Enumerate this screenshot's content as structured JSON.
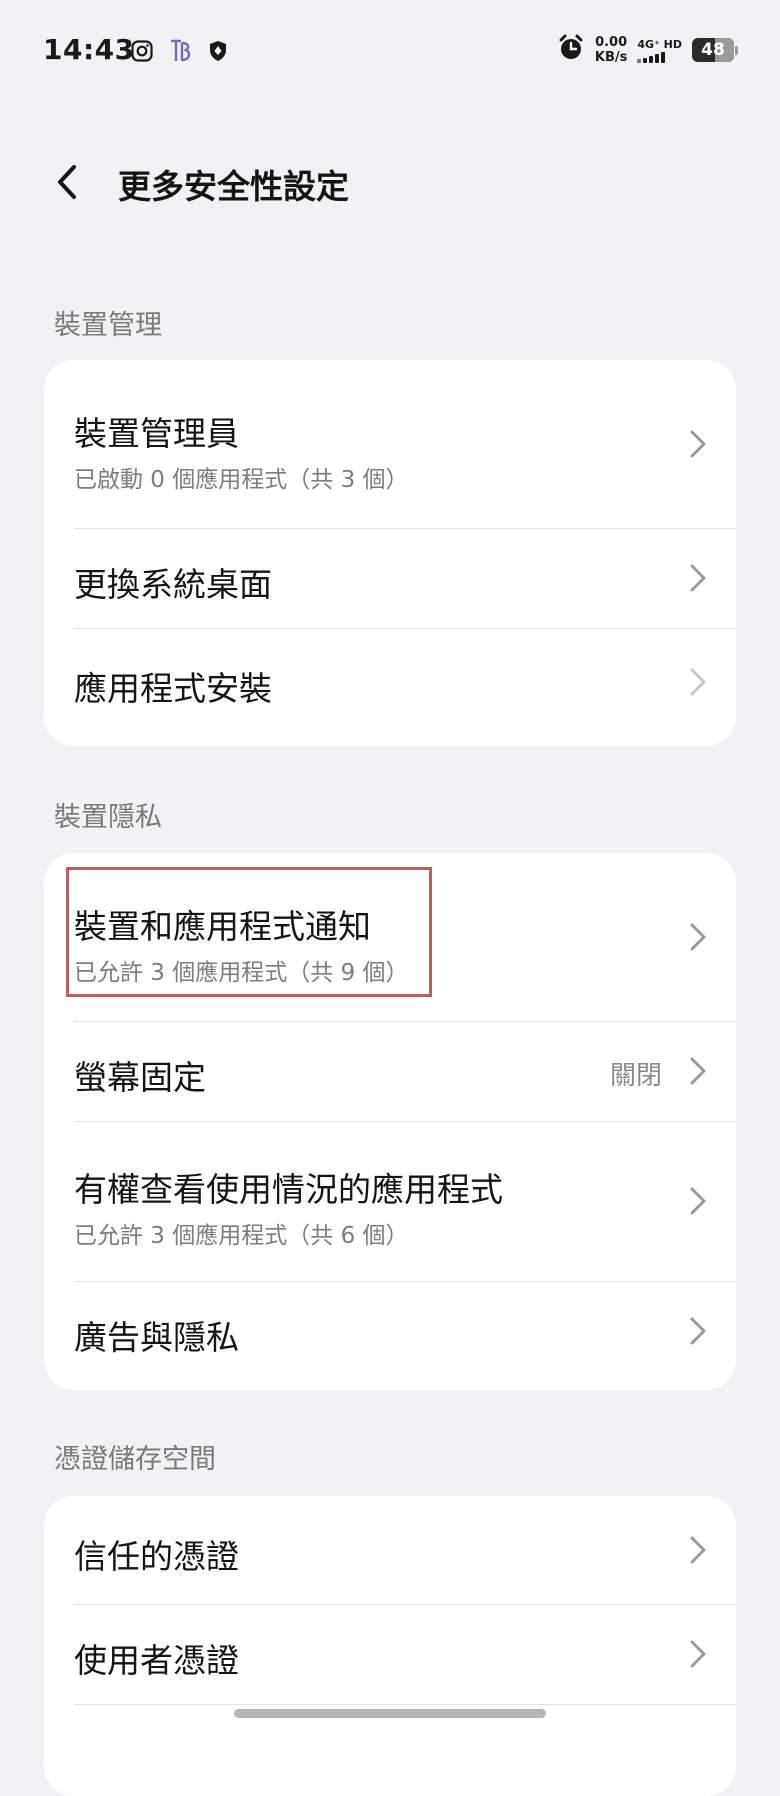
{
  "status_bar": {
    "time": "14:43",
    "net_speed_value": "0.00",
    "net_speed_unit": "KB/s",
    "network_type": "4G⁺ HD",
    "battery": "48"
  },
  "header": {
    "title": "更多安全性設定"
  },
  "sections": {
    "device_management": {
      "label": "裝置管理",
      "items": [
        {
          "title": "裝置管理員",
          "subtitle": "已啟動 0 個應用程式（共 3 個）"
        },
        {
          "title": "更換系統桌面"
        },
        {
          "title": "應用程式安裝"
        }
      ]
    },
    "device_privacy": {
      "label": "裝置隱私",
      "items": [
        {
          "title": "裝置和應用程式通知",
          "subtitle": "已允許 3 個應用程式（共 9 個）"
        },
        {
          "title": "螢幕固定",
          "value": "關閉"
        },
        {
          "title": "有權查看使用情況的應用程式",
          "subtitle": "已允許 3 個應用程式（共 6 個）"
        },
        {
          "title": "廣告與隱私"
        }
      ]
    },
    "credential_storage": {
      "label": "憑證儲存空間",
      "items": [
        {
          "title": "信任的憑證"
        },
        {
          "title": "使用者憑證"
        }
      ]
    }
  },
  "colors": {
    "background": "#f2f2f4",
    "card": "#ffffff",
    "highlight": "#c25b5b",
    "secondary_text": "#7d7d7d"
  },
  "icons": {
    "back": "chevron-left-icon",
    "row_arrow": "chevron-right-icon",
    "status": [
      "instagram-icon",
      "app-logo-icon",
      "shield-icon",
      "alarm-clock-icon",
      "signal-icon",
      "battery-icon"
    ]
  }
}
